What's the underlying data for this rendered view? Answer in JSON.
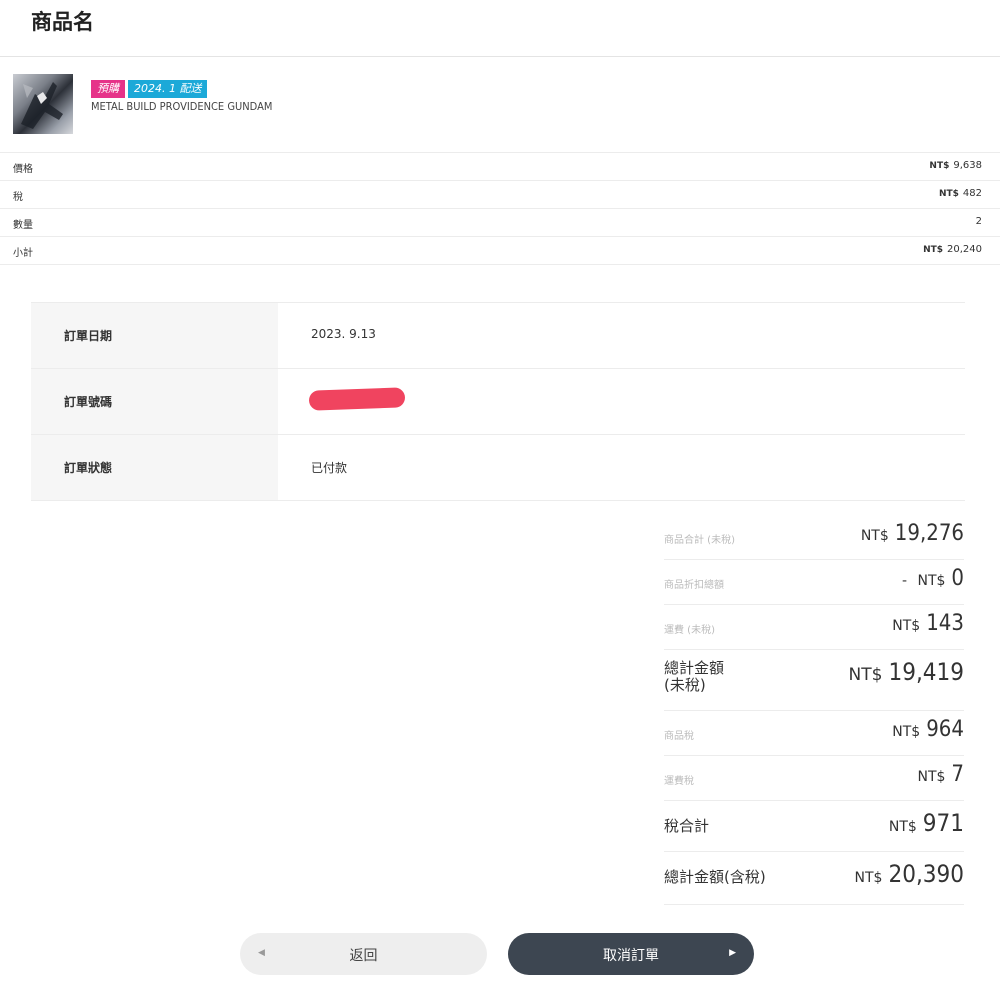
{
  "header": {
    "title": "商品名"
  },
  "product": {
    "tags": [
      "預購",
      "2024. 1 配送"
    ],
    "name": "METAL BUILD PROVIDENCE GUNDAM",
    "image_icon": "gundam-figure-thumbnail"
  },
  "prices": [
    {
      "label": "價格",
      "currency": "NT$",
      "value": "9,638"
    },
    {
      "label": "稅",
      "currency": "NT$",
      "value": "482"
    },
    {
      "label": "數量",
      "currency": "",
      "value": "2"
    },
    {
      "label": "小計",
      "currency": "NT$",
      "value": "20,240"
    }
  ],
  "order_info": [
    {
      "label": "訂單日期",
      "value": "2023. 9.13"
    },
    {
      "label": "訂單號碼",
      "value": ""
    },
    {
      "label": "訂單狀態",
      "value": "已付款"
    }
  ],
  "summary": [
    {
      "label": "商品合計 (未稅)",
      "prefix": "",
      "currency": "NT$",
      "value": "19,276"
    },
    {
      "label": "商品折扣總額",
      "prefix": "- ",
      "currency": "NT$",
      "value": "0"
    },
    {
      "label": "運費 (未稅)",
      "prefix": "",
      "currency": "NT$",
      "value": "143"
    },
    {
      "label": "總計金額\n(未稅)",
      "prefix": "",
      "currency": "NT$",
      "value": "19,419"
    },
    {
      "label": "商品稅",
      "prefix": "",
      "currency": "NT$",
      "value": "964"
    },
    {
      "label": "運費稅",
      "prefix": "",
      "currency": "NT$",
      "value": "7"
    },
    {
      "label": "稅合計",
      "prefix": "",
      "currency": "NT$",
      "value": "971"
    },
    {
      "label": "總計金額(含稅)",
      "prefix": "",
      "currency": "NT$",
      "value": "20,390"
    }
  ],
  "buttons": {
    "back": "返回",
    "cancel": "取消訂單"
  },
  "colors": {
    "tag_pink": "#e63389",
    "tag_blue": "#1ca9d8",
    "cancel_button": "#3d4651",
    "redaction": "#f0445f"
  }
}
